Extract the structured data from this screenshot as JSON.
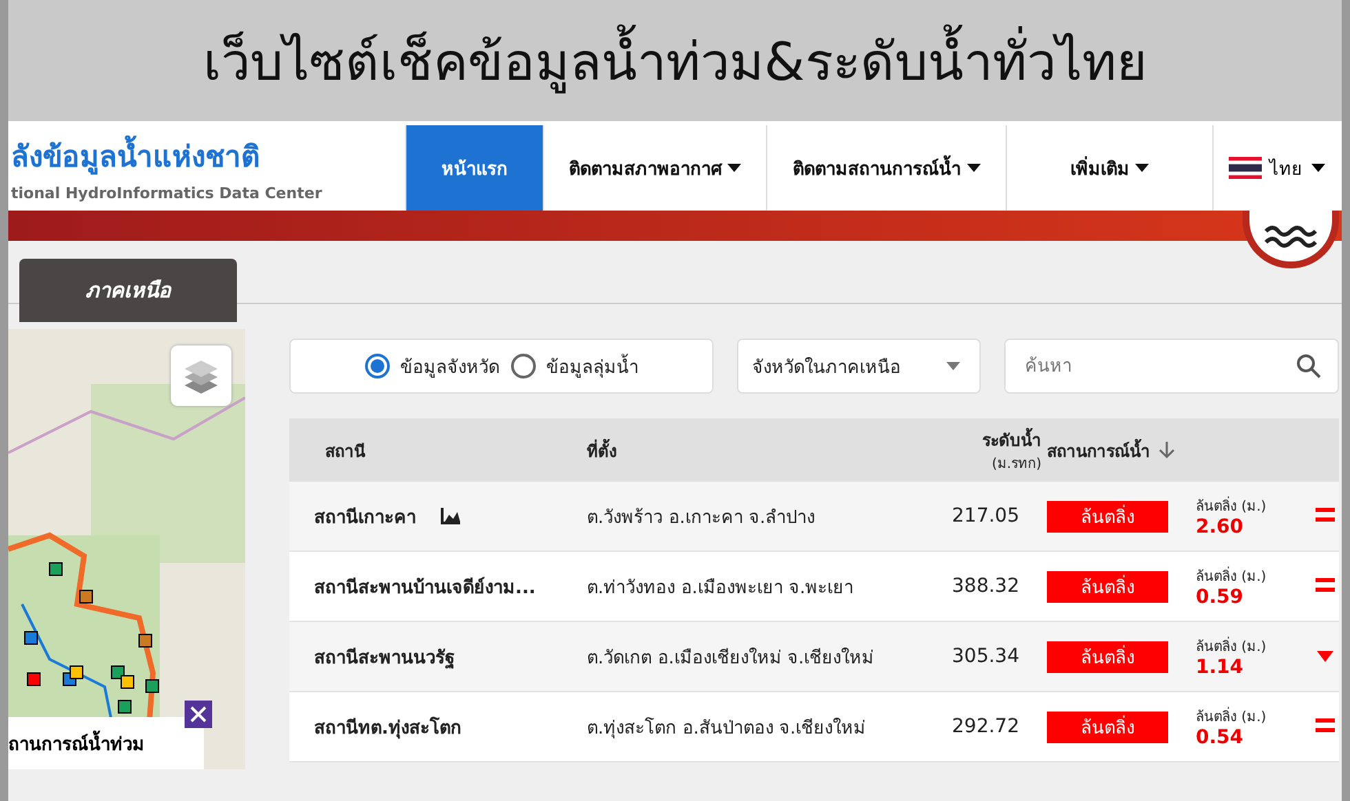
{
  "banner_title": "เว็บไซต์เช็คข้อมูลน้ำท่วม&ระดับน้ำทั่วไทย",
  "logo": {
    "title": "ลังข้อมูลน้ำแห่งชาติ",
    "subtitle": "tional HydroInformatics Data Center"
  },
  "nav": [
    {
      "label": "หน้าแรก",
      "selected": true,
      "dropdown": false
    },
    {
      "label": "ติดตามสภาพอากาศ",
      "selected": false,
      "dropdown": true
    },
    {
      "label": "ติดตามสถานการณ์น้ำ",
      "selected": false,
      "dropdown": true
    },
    {
      "label": "เพิ่มเติม",
      "selected": false,
      "dropdown": true
    }
  ],
  "language": {
    "label": "ไทย"
  },
  "tabs": [
    {
      "label": "ภาคเหนือ",
      "selected": true
    }
  ],
  "map": {
    "popup_text": "ถานการณ์น้ำท่วม"
  },
  "filters": {
    "radios": [
      {
        "label": "ข้อมูลจังหวัด",
        "selected": true
      },
      {
        "label": "ข้อมูลลุ่มน้ำ",
        "selected": false
      }
    ],
    "select": {
      "value": "จังหวัดในภาคเหนือ"
    },
    "search": {
      "placeholder": "ค้นหา"
    }
  },
  "table": {
    "columns": [
      {
        "label": "สถานี"
      },
      {
        "label": "ที่ตั้ง"
      },
      {
        "label": "ระดับน้ำ",
        "sublabel": "(ม.รทก)"
      },
      {
        "label": "สถานการณ์น้ำ",
        "sorted": true
      }
    ],
    "rows": [
      {
        "station": "สถานีเกาะคา",
        "has_chart": true,
        "location": "ต.วังพร้าว อ.เกาะคา จ.ลำปาง",
        "level": "217.05",
        "status": "ล้นตลิ่ง",
        "threshold_label": "ล้นตลิ่ง (ม.)",
        "threshold": "2.60",
        "kind": "steady"
      },
      {
        "station": "สถานีสะพานบ้านเจดีย์งาม...",
        "has_chart": false,
        "location": "ต.ท่าวังทอง อ.เมืองพะเยา จ.พะเยา",
        "level": "388.32",
        "status": "ล้นตลิ่ง",
        "threshold_label": "ล้นตลิ่ง (ม.)",
        "threshold": "0.59",
        "kind": "steady"
      },
      {
        "station": "สถานีสะพานนวรัฐ",
        "has_chart": false,
        "location": "ต.วัดเกต อ.เมืองเชียงใหม่ จ.เชียงใหม่",
        "level": "305.34",
        "status": "ล้นตลิ่ง",
        "threshold_label": "ล้นตลิ่ง (ม.)",
        "threshold": "1.14",
        "kind": "down"
      },
      {
        "station": "สถานีทต.ทุ่งสะโตก",
        "has_chart": false,
        "location": "ต.ทุ่งสะโตก อ.สันป่าตอง จ.เชียงใหม่",
        "level": "292.72",
        "status": "ล้นตลิ่ง",
        "threshold_label": "ล้นตลิ่ง (ม.)",
        "threshold": "0.54",
        "kind": "steady"
      }
    ]
  }
}
